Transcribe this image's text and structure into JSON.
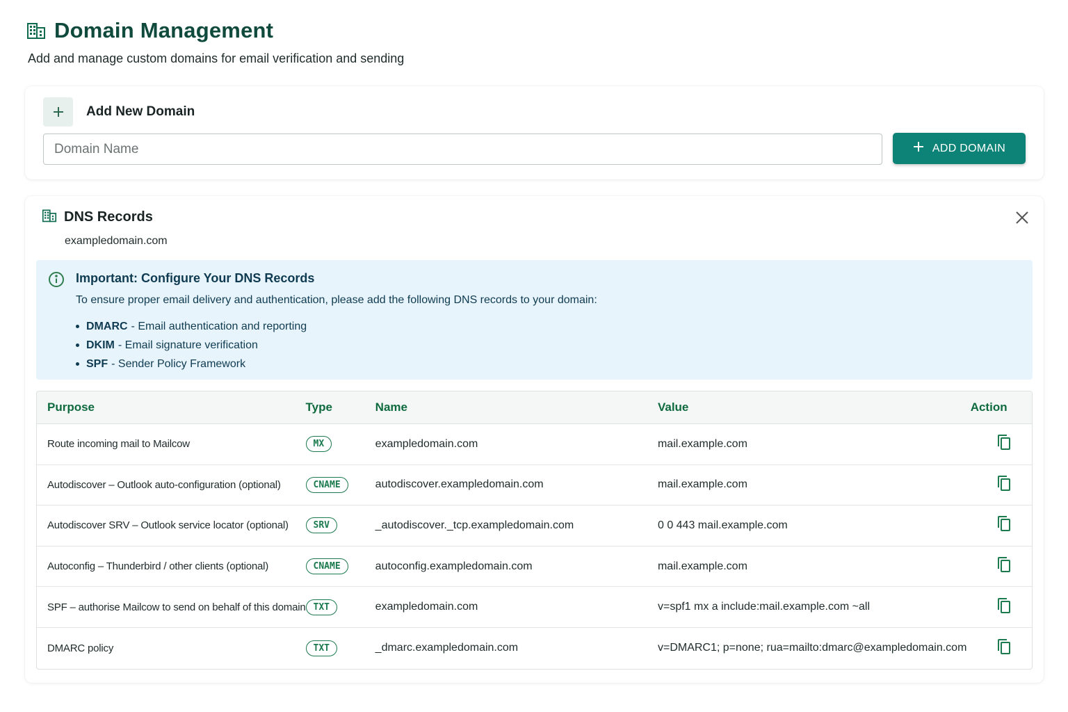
{
  "header": {
    "title": "Domain Management",
    "subtitle": "Add and manage custom domains for email verification and sending"
  },
  "add_domain": {
    "title": "Add New Domain",
    "input_placeholder": "Domain Name",
    "input_value": "",
    "button_label": "ADD DOMAIN"
  },
  "dns": {
    "title": "DNS Records",
    "domain": "exampledomain.com",
    "info": {
      "title": "Important: Configure Your DNS Records",
      "text": "To ensure proper email delivery and authentication, please add the following DNS records to your domain:",
      "items": [
        {
          "name": "DMARC",
          "desc": "- Email authentication and reporting"
        },
        {
          "name": "DKIM",
          "desc": "- Email signature verification"
        },
        {
          "name": "SPF",
          "desc": "- Sender Policy Framework"
        }
      ]
    },
    "columns": {
      "purpose": "Purpose",
      "type": "Type",
      "name": "Name",
      "value": "Value",
      "action": "Action"
    },
    "records": [
      {
        "purpose": "Route incoming mail to Mailcow",
        "type": "MX",
        "name": "exampledomain.com",
        "value": "mail.example.com"
      },
      {
        "purpose": "Autodiscover – Outlook auto-configuration (optional)",
        "type": "CNAME",
        "name": "autodiscover.exampledomain.com",
        "value": "mail.example.com"
      },
      {
        "purpose": "Autodiscover SRV – Outlook service locator (optional)",
        "type": "SRV",
        "name": "_autodiscover._tcp.exampledomain.com",
        "value": "0 0 443 mail.example.com"
      },
      {
        "purpose": "Autoconfig – Thunderbird / other clients (optional)",
        "type": "CNAME",
        "name": "autoconfig.exampledomain.com",
        "value": "mail.example.com"
      },
      {
        "purpose": "SPF – authorise Mailcow to send on behalf of this domain",
        "type": "TXT",
        "name": "exampledomain.com",
        "value": "v=spf1 mx a include:mail.example.com ~all"
      },
      {
        "purpose": "DMARC policy",
        "type": "TXT",
        "name": "_dmarc.exampledomain.com",
        "value": "v=DMARC1; p=none; rua=mailto:dmarc@exampledomain.com"
      }
    ]
  },
  "colors": {
    "brand_dark": "#0f4a3c",
    "accent": "#0d8377",
    "badge": "#1b7a4e",
    "info_bg": "#e8f4fb"
  },
  "icons": {
    "title": "building-icon",
    "add": "plus-icon",
    "close": "close-icon",
    "info": "info-icon",
    "copy": "copy-icon"
  }
}
